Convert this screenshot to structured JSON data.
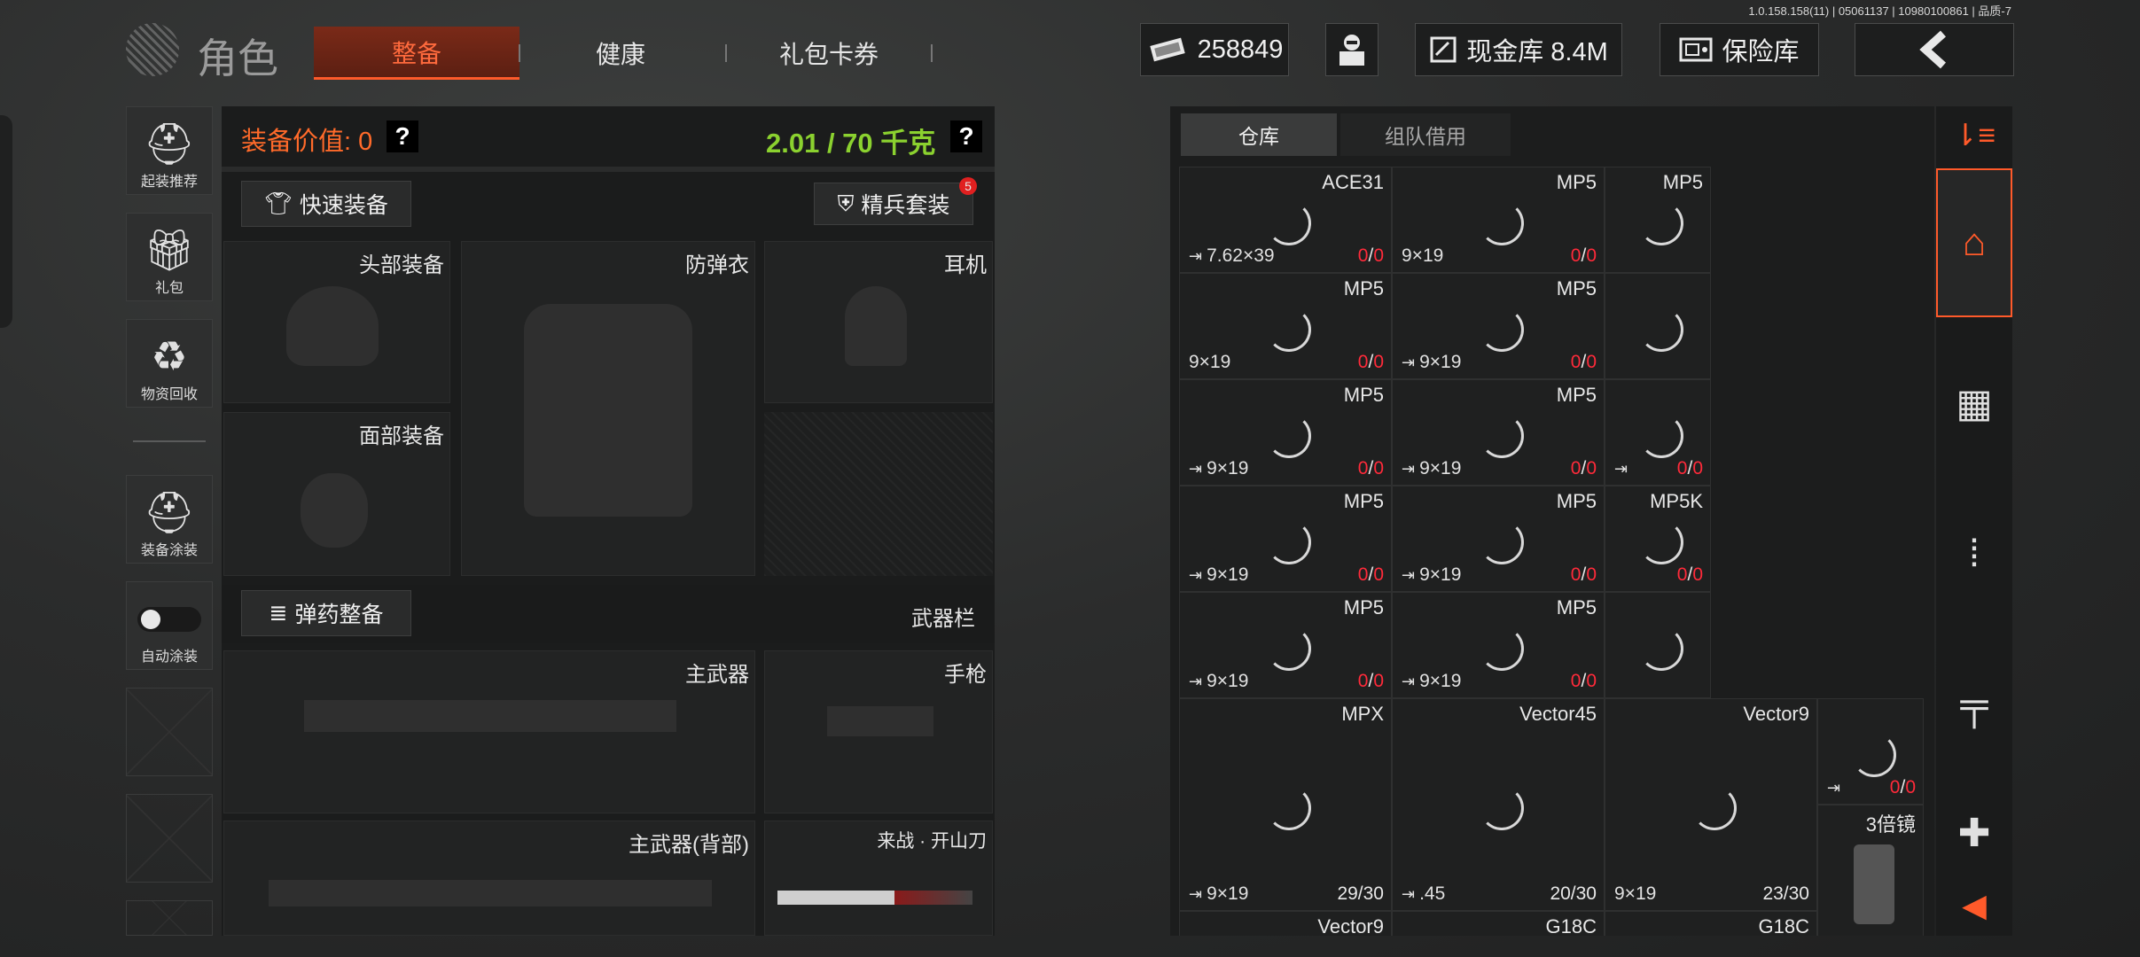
{
  "version": "1.0.158.158(11) | 05061137 | 10980100861 | 品质-7",
  "header": {
    "title": "角色",
    "tabs": [
      "整备",
      "健康",
      "礼包卡券"
    ],
    "money": "258849",
    "cash_vault": "现金库 8.4M",
    "safe": "保险库"
  },
  "rail": {
    "items": [
      "起装推荐",
      "礼包",
      "物资回收",
      "装备涂装",
      "自动涂装"
    ]
  },
  "equip": {
    "value_label": "装备价值: 0",
    "weight": "2.01 / 70 千克",
    "quick_equip": "快速装备",
    "elite_set": "精兵套装",
    "elite_badge": "5",
    "slots": {
      "head": "头部装备",
      "armor": "防弹衣",
      "earphone": "耳机",
      "face": "面部装备",
      "ammo_btn": "弹药整备",
      "weapon_bar": "武器栏",
      "primary": "主武器",
      "pistol": "手枪",
      "primary_back": "主武器(背部)",
      "melee": "来战 · 开山刀"
    }
  },
  "warehouse": {
    "tabs": [
      "仓库",
      "组队借用"
    ],
    "small_items": [
      {
        "name": "ACE31",
        "cal": "7.62×39",
        "count": "0/0",
        "arrow": true
      },
      {
        "name": "MP5",
        "cal": "9×19",
        "count": "0/0",
        "arrow": false
      },
      {
        "name": "MP5",
        "cal": "",
        "count": "",
        "arrow": false
      },
      {
        "name": "MP5",
        "cal": "9×19",
        "count": "0/0",
        "arrow": false
      },
      {
        "name": "MP5",
        "cal": "9×19",
        "count": "0/0",
        "arrow": true
      },
      {
        "name": "",
        "cal": "",
        "count": "",
        "arrow": false
      },
      {
        "name": "MP5",
        "cal": "9×19",
        "count": "0/0",
        "arrow": true
      },
      {
        "name": "MP5",
        "cal": "9×19",
        "count": "0/0",
        "arrow": true
      },
      {
        "name": "",
        "cal": "",
        "count": "0/0",
        "arrow": true
      },
      {
        "name": "MP5",
        "cal": "9×19",
        "count": "0/0",
        "arrow": true
      },
      {
        "name": "MP5",
        "cal": "9×19",
        "count": "0/0",
        "arrow": true
      },
      {
        "name": "MP5K",
        "cal": "",
        "count": "0/0",
        "arrow": false
      },
      {
        "name": "MP5",
        "cal": "9×19",
        "count": "0/0",
        "arrow": true
      },
      {
        "name": "MP5",
        "cal": "9×19",
        "count": "0/0",
        "arrow": true
      },
      {
        "name": "",
        "cal": "",
        "count": "",
        "arrow": false
      }
    ],
    "large_items": [
      {
        "name": "MPX",
        "cal": "9×19",
        "count": "29/30",
        "arrow": true
      },
      {
        "name": "Vector45",
        "cal": ".45",
        "count": "20/30",
        "arrow": true
      },
      {
        "name": "Vector9",
        "cal": "9×19",
        "count": "23/30",
        "arrow": false
      }
    ],
    "side_small": {
      "count": "0/0"
    },
    "scope": "3倍镜",
    "bottom_items": [
      "Vector9",
      "G18C",
      "G18C"
    ]
  },
  "colors": {
    "accent": "#ff5a2a",
    "weight_green": "#8bd12f",
    "value_orange": "#ff6a2a",
    "count_red": "#ff2a3a"
  }
}
